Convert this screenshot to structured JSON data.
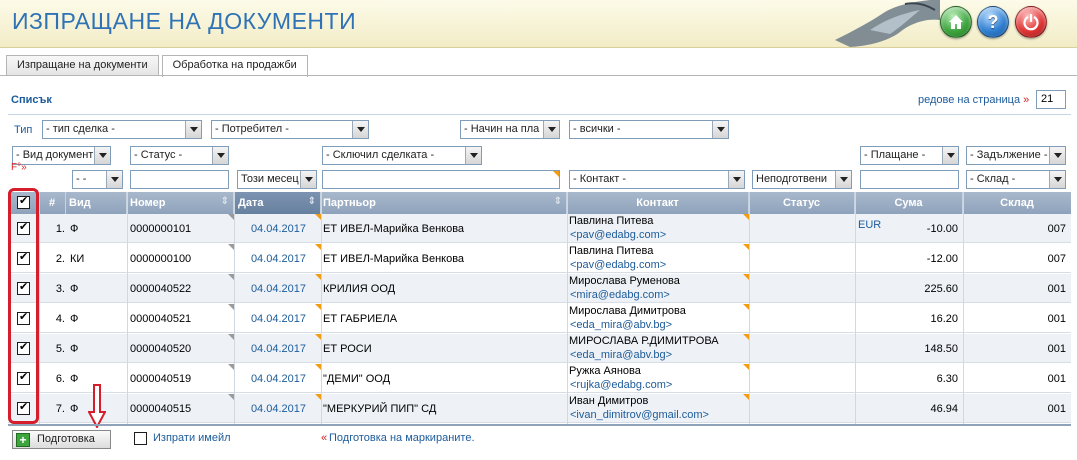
{
  "header": {
    "title": "ИЗПРАЩАНЕ НА ДОКУМЕНТИ"
  },
  "tabs": [
    {
      "label": "Изпращане на документи",
      "active": false
    },
    {
      "label": "Обработка на продажби",
      "active": true
    }
  ],
  "list": {
    "title": "Списък",
    "rows_per_page_label": "редове на страница",
    "rows_per_page": "21"
  },
  "filters": {
    "type_label": "Тип",
    "fx_label": "F°»",
    "row1": {
      "deal_type": "- тип сделка -",
      "consumer": "- Потребител -",
      "payment_method": "- Начин на пла",
      "all": "- всички -"
    },
    "row2": {
      "doc_type": "- Вид документ",
      "status": "- Статус -",
      "closed_by": "- Сключил сделката -",
      "payment": "- Плащане -",
      "debt": "- Задължение -"
    },
    "row3": {
      "dash": "- -",
      "month": "Този месец",
      "contact": "- Контакт -",
      "unprepared": "Неподготвени",
      "warehouse": "- Склад -"
    }
  },
  "table": {
    "columns": [
      "#",
      "Вид",
      "Номер",
      "Дата",
      "Партньор",
      "Контакт",
      "Статус",
      "Сума",
      "Склад"
    ],
    "rows": [
      {
        "n": "1.",
        "kind": "Ф",
        "number": "0000000101",
        "date": "04.04.2017",
        "partner": "ЕТ ИВЕЛ-Марийка Венкова",
        "contact_name": "Павлина Питева",
        "contact_email": "<pav@edabg.com>",
        "currency": "EUR",
        "amount": "-10.00",
        "warehouse": "007"
      },
      {
        "n": "2.",
        "kind": "КИ",
        "number": "0000000100",
        "date": "04.04.2017",
        "partner": "ЕТ ИВЕЛ-Марийка Венкова",
        "contact_name": "Павлина Питева",
        "contact_email": "<pav@edabg.com>",
        "currency": "",
        "amount": "-12.00",
        "warehouse": "007"
      },
      {
        "n": "3.",
        "kind": "Ф",
        "number": "0000040522",
        "date": "04.04.2017",
        "partner": "КРИЛИЯ ООД",
        "contact_name": "Мирослава Руменова",
        "contact_email": "<mira@edabg.com>",
        "currency": "",
        "amount": "225.60",
        "warehouse": "001"
      },
      {
        "n": "4.",
        "kind": "Ф",
        "number": "0000040521",
        "date": "04.04.2017",
        "partner": "ЕТ ГАБРИЕЛА",
        "contact_name": "Мирослава Димитрова",
        "contact_email": "<eda_mira@abv.bg>",
        "currency": "",
        "amount": "16.20",
        "warehouse": "001"
      },
      {
        "n": "5.",
        "kind": "Ф",
        "number": "0000040520",
        "date": "04.04.2017",
        "partner": "ЕТ РОСИ",
        "contact_name": "МИРОСЛАВА Р.ДИМИТРОВА",
        "contact_email": "<eda_mira@abv.bg>",
        "currency": "",
        "amount": "148.50",
        "warehouse": "001"
      },
      {
        "n": "6.",
        "kind": "Ф",
        "number": "0000040519",
        "date": "04.04.2017",
        "partner": "\"ДЕМИ\" ООД",
        "contact_name": "Ружка Аянова",
        "contact_email": "<rujka@edabg.com>",
        "currency": "",
        "amount": "6.30",
        "warehouse": "001"
      },
      {
        "n": "7.",
        "kind": "Ф",
        "number": "0000040515",
        "date": "04.04.2017",
        "partner": "\"МЕРКУРИЙ ПИП\" СД",
        "contact_name": "Иван Димитров",
        "contact_email": "<ivan_dimitrov@gmail.com>",
        "currency": "",
        "amount": "46.94",
        "warehouse": "001"
      }
    ]
  },
  "footer": {
    "prepare_button": "Подготовка",
    "send_email": "Изпрати имейл",
    "hint_marker": "«",
    "hint": "Подготовка на маркираните."
  }
}
